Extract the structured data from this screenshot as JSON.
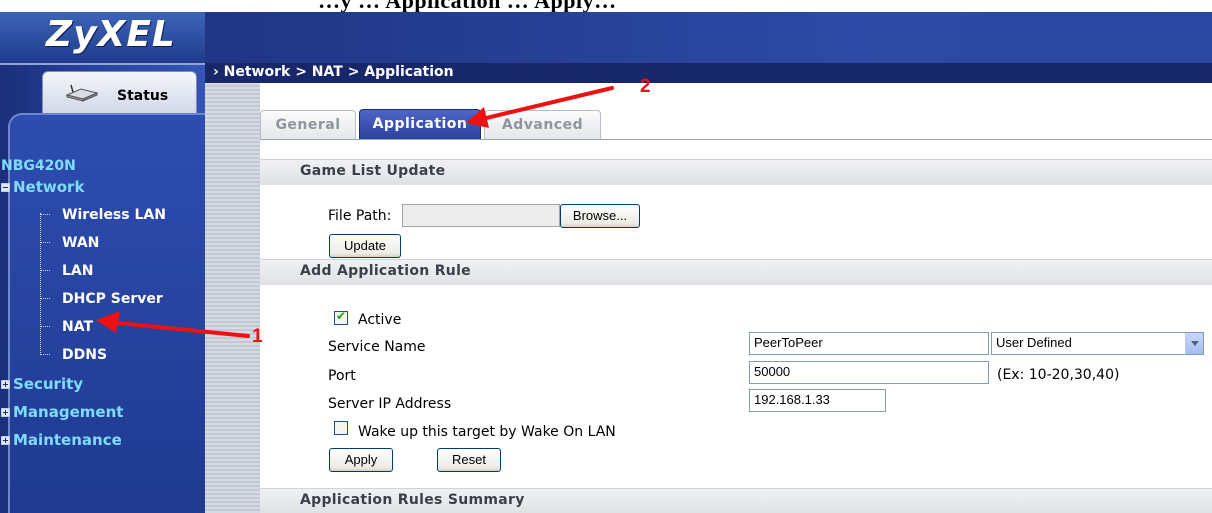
{
  "caption": "…y … Application … Apply…",
  "header": {
    "logo": "ZyXEL"
  },
  "sidebar": {
    "status_label": "Status",
    "model": "NBG420N",
    "groups": [
      {
        "label": "Network",
        "expanded": true
      },
      {
        "label": "Security",
        "expanded": false
      },
      {
        "label": "Management",
        "expanded": false
      },
      {
        "label": "Maintenance",
        "expanded": false
      }
    ],
    "network_items": [
      "Wireless LAN",
      "WAN",
      "LAN",
      "DHCP Server",
      "NAT",
      "DDNS"
    ]
  },
  "breadcrumb": "Network > NAT > Application",
  "tabs": [
    "General",
    "Application",
    "Advanced"
  ],
  "active_tab": "Application",
  "game_list": {
    "title": "Game List Update",
    "file_path_label": "File Path:",
    "file_path_value": "",
    "browse_label": "Browse...",
    "update_label": "Update"
  },
  "add_rule": {
    "title": "Add Application Rule",
    "active_label": "Active",
    "active_checked": true,
    "service_name_label": "Service Name",
    "service_name_value": "PeerToPeer",
    "service_type": "User Defined",
    "port_label": "Port",
    "port_value": "50000",
    "port_hint": "(Ex: 10-20,30,40)",
    "server_ip_label": "Server IP Address",
    "server_ip_value": "192.168.1.33",
    "wol_label": "Wake up this target by Wake On LAN",
    "wol_checked": false,
    "apply_label": "Apply",
    "reset_label": "Reset"
  },
  "summary": {
    "title": "Application Rules Summary"
  },
  "annotations": {
    "marker_1": "1",
    "marker_2": "2",
    "color": "#e11111"
  }
}
